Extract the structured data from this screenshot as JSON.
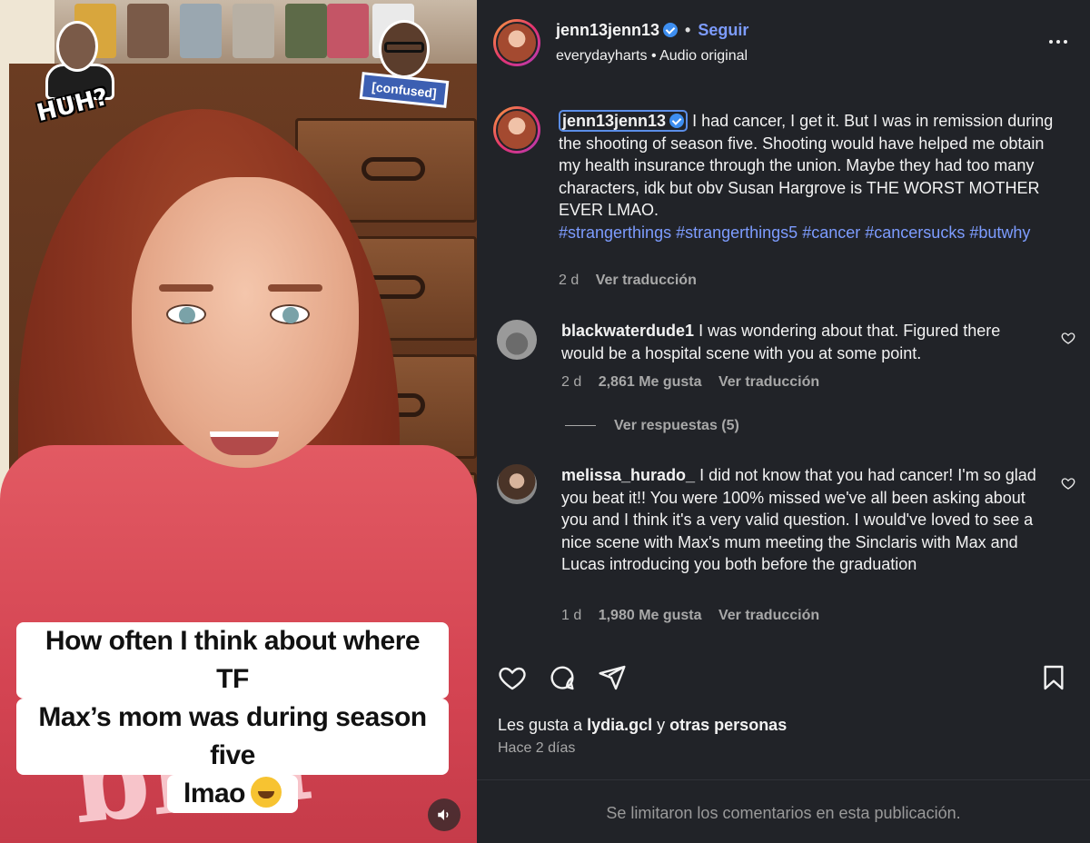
{
  "post": {
    "username": "jenn13jenn13",
    "separator": "•",
    "follow_label": "Seguir",
    "audio": "everydayharts • Audio original"
  },
  "video": {
    "sticker_huh": "HUH?",
    "sticker_confused": "[confused]",
    "caption_line1": "How often I think about where TF",
    "caption_line2": "Max’s mom was during season five",
    "caption_line3": "lmao",
    "emoji_icon": "rofl-emoji",
    "mute_icon": "speaker-icon"
  },
  "caption": {
    "username": "jenn13jenn13",
    "text": "I had cancer, I get it. But I was in remission during the shooting of season five. Shooting would have helped me obtain my health insurance through the union. Maybe they had too many characters, idk but obv Susan Hargrove is THE WORST MOTHER EVER LMAO.",
    "hashtags": [
      "#strangerthings",
      "#strangerthings5",
      "#cancer",
      "#cancersucks",
      "#butwhy"
    ],
    "time": "2 d",
    "translate": "Ver traducción"
  },
  "comments": [
    {
      "username": "blackwaterdude1",
      "text": "I was wondering about that. Figured there would be a hospital scene with you at some point.",
      "time": "2 d",
      "likes": "2,861 Me gusta",
      "translate": "Ver traducción",
      "replies": "Ver respuestas (5)"
    },
    {
      "username": "melissa_hurado_",
      "text": "I did not know that you had cancer! I'm so glad you beat it!! You were 100% missed we've all been asking about you and I think it's a very valid question. I would've loved to see a nice scene with Max's mum meeting the Sinclaris with Max and Lucas introducing you both before the graduation",
      "time": "1 d",
      "likes": "1,980 Me gusta",
      "translate": "Ver traducción"
    }
  ],
  "footer": {
    "likes_prefix": "Les gusta a",
    "likes_user": "lydia.gcl",
    "likes_and": "y",
    "likes_others": "otras personas",
    "posted_ago": "Hace 2 días",
    "comments_limited": "Se limitaron los comentarios en esta publicación."
  },
  "colors": {
    "panel_bg": "#212328",
    "link_blue": "#7d9cff",
    "muted_text": "#a8a8a8",
    "verified_blue": "#3d8ef0"
  }
}
